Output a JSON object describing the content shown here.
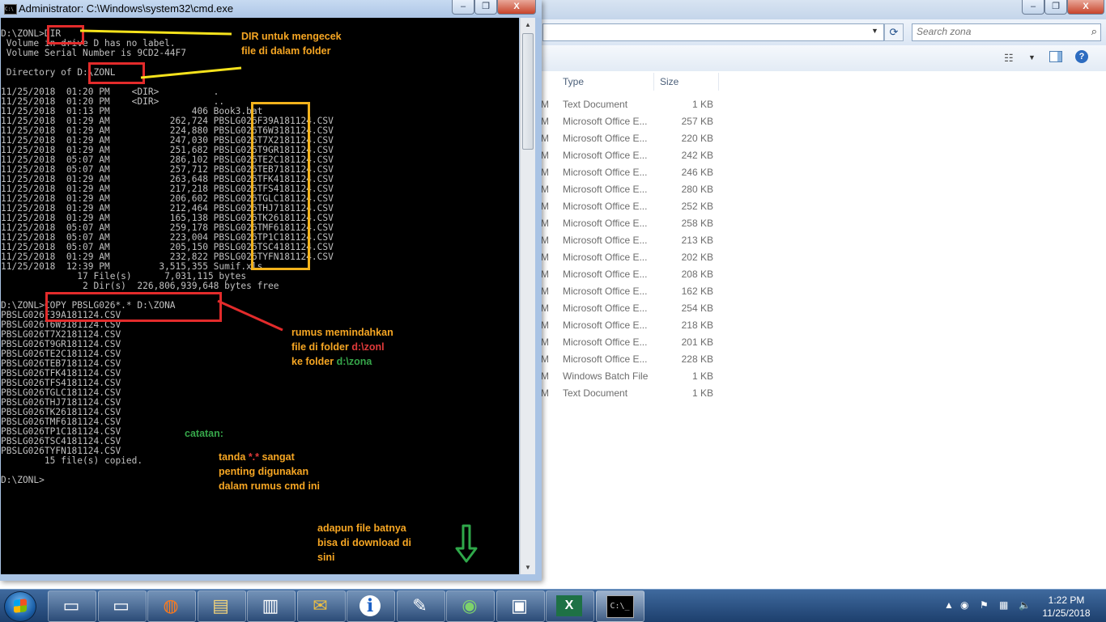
{
  "explorer": {
    "search_placeholder": "Search zona",
    "columns": {
      "type": "Type",
      "size": "Size"
    },
    "rows": [
      {
        "m": "M",
        "type": "Text Document",
        "size": "1 KB"
      },
      {
        "m": "M",
        "type": "Microsoft Office E...",
        "size": "257 KB"
      },
      {
        "m": "M",
        "type": "Microsoft Office E...",
        "size": "220 KB"
      },
      {
        "m": "M",
        "type": "Microsoft Office E...",
        "size": "242 KB"
      },
      {
        "m": "M",
        "type": "Microsoft Office E...",
        "size": "246 KB"
      },
      {
        "m": "M",
        "type": "Microsoft Office E...",
        "size": "280 KB"
      },
      {
        "m": "M",
        "type": "Microsoft Office E...",
        "size": "252 KB"
      },
      {
        "m": "M",
        "type": "Microsoft Office E...",
        "size": "258 KB"
      },
      {
        "m": "M",
        "type": "Microsoft Office E...",
        "size": "213 KB"
      },
      {
        "m": "M",
        "type": "Microsoft Office E...",
        "size": "202 KB"
      },
      {
        "m": "M",
        "type": "Microsoft Office E...",
        "size": "208 KB"
      },
      {
        "m": "M",
        "type": "Microsoft Office E...",
        "size": "162 KB"
      },
      {
        "m": "M",
        "type": "Microsoft Office E...",
        "size": "254 KB"
      },
      {
        "m": "M",
        "type": "Microsoft Office E...",
        "size": "218 KB"
      },
      {
        "m": "M",
        "type": "Microsoft Office E...",
        "size": "201 KB"
      },
      {
        "m": "M",
        "type": "Microsoft Office E...",
        "size": "228 KB"
      },
      {
        "m": "M",
        "type": "Windows Batch File",
        "size": "1 KB"
      },
      {
        "m": "M",
        "type": "Text Document",
        "size": "1 KB"
      }
    ]
  },
  "cmd": {
    "title": "Administrator: C:\\Windows\\system32\\cmd.exe",
    "icon_text": "C:\\",
    "window_buttons": {
      "minimize": "–",
      "restore": "❒",
      "close": "X"
    },
    "lines": [
      "D:\\ZONL>DIR",
      " Volume in drive D has no label.",
      " Volume Serial Number is 9CD2-44F7",
      "",
      " Directory of D:\\ZONL",
      "",
      "11/25/2018  01:20 PM    <DIR>          .",
      "11/25/2018  01:20 PM    <DIR>          ..",
      "11/25/2018  01:13 PM               406 Book3.bat",
      "11/25/2018  01:29 AM           262,724 PBSLG026F39A181124.CSV",
      "11/25/2018  01:29 AM           224,880 PBSLG026T6W3181124.CSV",
      "11/25/2018  01:29 AM           247,030 PBSLG026T7X2181124.CSV",
      "11/25/2018  01:29 AM           251,682 PBSLG026T9GR181124.CSV",
      "11/25/2018  05:07 AM           286,102 PBSLG026TE2C181124.CSV",
      "11/25/2018  05:07 AM           257,712 PBSLG026TEB7181124.CSV",
      "11/25/2018  01:29 AM           263,648 PBSLG026TFK4181124.CSV",
      "11/25/2018  01:29 AM           217,218 PBSLG026TFS4181124.CSV",
      "11/25/2018  01:29 AM           206,602 PBSLG026TGLC181124.CSV",
      "11/25/2018  01:29 AM           212,464 PBSLG026THJ7181124.CSV",
      "11/25/2018  01:29 AM           165,138 PBSLG026TK26181124.CSV",
      "11/25/2018  05:07 AM           259,178 PBSLG026TMF6181124.CSV",
      "11/25/2018  05:07 AM           223,004 PBSLG026TP1C181124.CSV",
      "11/25/2018  05:07 AM           205,150 PBSLG026TSC4181124.CSV",
      "11/25/2018  01:29 AM           232,822 PBSLG026TYFN181124.CSV",
      "11/25/2018  12:39 PM         3,515,355 Sumif.xls",
      "              17 File(s)      7,031,115 bytes",
      "               2 Dir(s)  226,806,939,648 bytes free",
      "",
      "D:\\ZONL>COPY PBSLG026*.* D:\\ZONA",
      "PBSLG026F39A181124.CSV",
      "PBSLG026T6W3181124.CSV",
      "PBSLG026T7X2181124.CSV",
      "PBSLG026T9GR181124.CSV",
      "PBSLG026TE2C181124.CSV",
      "PBSLG026TEB7181124.CSV",
      "PBSLG026TFK4181124.CSV",
      "PBSLG026TFS4181124.CSV",
      "PBSLG026TGLC181124.CSV",
      "PBSLG026THJ7181124.CSV",
      "PBSLG026TK26181124.CSV",
      "PBSLG026TMF6181124.CSV",
      "PBSLG026TP1C181124.CSV",
      "PBSLG026TSC4181124.CSV",
      "PBSLG026TYFN181124.CSV",
      "        15 file(s) copied.",
      "",
      "D:\\ZONL>"
    ]
  },
  "annotations": {
    "dir_note": [
      "DIR untuk mengecek",
      "file di dalam folder"
    ],
    "copy_note": {
      "line1": "rumus memindahkan",
      "line2_prefix": "file di folder ",
      "line2_path": "d:\\zonl",
      "line3_prefix": "ke folder ",
      "line3_path": "d:\\zona"
    },
    "catatan": "catatan:",
    "tanda": {
      "prefix": "tanda ",
      "symbol": "*.*",
      "suffix": " sangat",
      "line2": "penting digunakan",
      "line3": "dalam rumus cmd ini"
    },
    "download": [
      "adapun file batnya",
      "bisa di download di",
      "sini"
    ],
    "colors": {
      "red": "#e32b2b",
      "yellow": "#f2b21c",
      "orange": "#f6a623",
      "green": "#36a64a"
    }
  },
  "taskbar": {
    "buttons": [
      {
        "name": "window-button-1",
        "icon": "window-icon"
      },
      {
        "name": "window-button-2",
        "icon": "window-icon"
      },
      {
        "name": "firefox-button",
        "icon": "firefox-icon"
      },
      {
        "name": "explorer-button",
        "icon": "folder-icon"
      },
      {
        "name": "reader-button",
        "icon": "document-icon"
      },
      {
        "name": "mail-button",
        "icon": "mail-icon"
      },
      {
        "name": "info-button",
        "icon": "info-icon"
      },
      {
        "name": "editor-button",
        "icon": "pen-document-icon"
      },
      {
        "name": "eye-button",
        "icon": "eye-icon"
      },
      {
        "name": "network-button",
        "icon": "monitor-icon"
      },
      {
        "name": "excel-button",
        "icon": "excel-icon"
      },
      {
        "name": "cmd-button",
        "icon": "cmd-icon"
      }
    ],
    "cmd_button_text": "C:\\_",
    "clock": {
      "time": "1:22 PM",
      "date": "11/25/2018"
    }
  }
}
